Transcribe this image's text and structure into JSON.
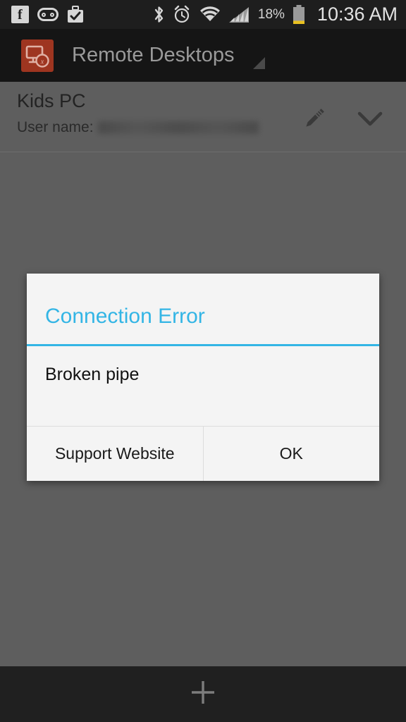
{
  "status_bar": {
    "notification_icons": [
      {
        "name": "facebook-icon",
        "label": "Facebook"
      },
      {
        "name": "voicemail-icon",
        "label": "Voicemail"
      },
      {
        "name": "work-profile-icon",
        "label": "Work profile"
      }
    ],
    "system_icons": [
      {
        "name": "bluetooth-icon",
        "label": "Bluetooth"
      },
      {
        "name": "alarm-icon",
        "label": "Alarm"
      },
      {
        "name": "wifi-icon",
        "label": "Wi-Fi"
      },
      {
        "name": "cellular-signal-icon",
        "label": "Cellular signal"
      }
    ],
    "battery_percent": "18%",
    "time": "10:36 AM",
    "background_color": "#1e1e1e",
    "text_color": "#e2e2e2"
  },
  "action_bar": {
    "app_icon_name": "remote-desktop-app-icon",
    "app_icon_color": "#9e3520",
    "title": "Remote Desktops",
    "title_color": "#9a9a9a",
    "background_color": "#151515",
    "overflow_indicator_name": "spinner-triangle-icon"
  },
  "connection_item": {
    "name": "Kids PC",
    "username_label": "User name:",
    "username_value": "",
    "username_redacted": true,
    "edit_icon_name": "pencil-icon",
    "expand_icon_name": "chevron-down-icon",
    "background_color": "#5e5e5e"
  },
  "dialog": {
    "title": "Connection Error",
    "title_color": "#33b5e5",
    "message": "Broken pipe",
    "background_color": "#f4f4f4",
    "buttons": [
      {
        "label": "Support Website",
        "name": "support-website-button"
      },
      {
        "label": "OK",
        "name": "ok-button"
      }
    ]
  },
  "bottom_bar": {
    "add_icon_name": "plus-icon",
    "background_color": "#202020"
  }
}
